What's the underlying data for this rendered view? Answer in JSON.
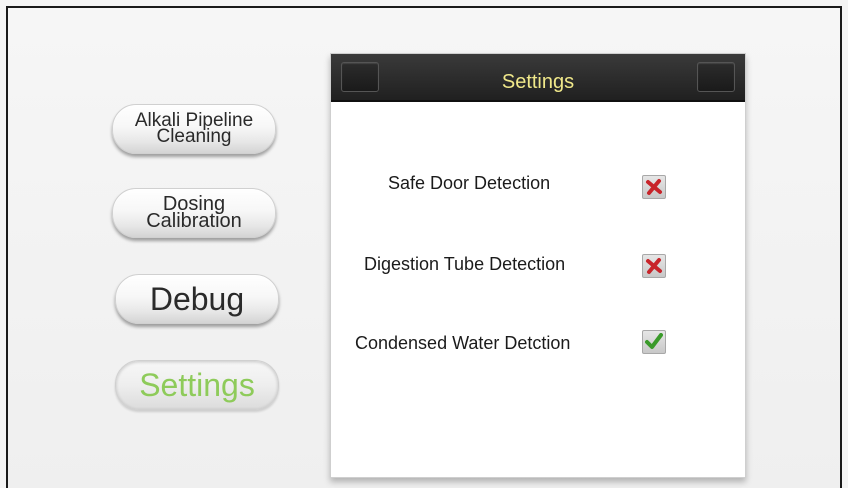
{
  "nav": {
    "alkali_pipeline_cleaning": "Alkali Pipeline\nCleaning",
    "dosing_calibration": "Dosing\nCalibration",
    "debug": "Debug",
    "settings": "Settings"
  },
  "panel": {
    "title": "Settings",
    "options": [
      {
        "label": "Safe Door Detection",
        "checked": false
      },
      {
        "label": "Digestion Tube Detection",
        "checked": false
      },
      {
        "label": "Condensed Water Detction",
        "checked": true
      }
    ]
  },
  "colors": {
    "active_nav": "#8ecb5a",
    "title_text": "#f0e88a",
    "cross": "#c8242a",
    "check": "#3a9a2a"
  }
}
